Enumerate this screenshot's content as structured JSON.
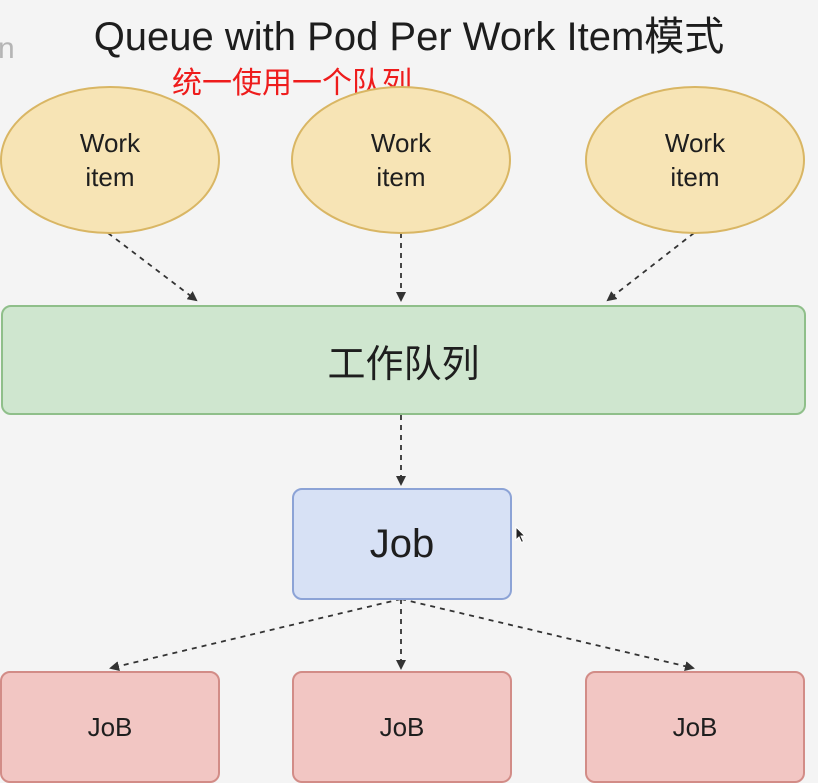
{
  "diagram": {
    "title": "Queue with Pod Per Work Item模式",
    "edge_glyph": "n",
    "annotation": "统一使用一个队列",
    "work_items": [
      {
        "line1": "Work",
        "line2": "item"
      },
      {
        "line1": "Work",
        "line2": "item"
      },
      {
        "line1": "Work",
        "line2": "item"
      }
    ],
    "queue_label": "工作队列",
    "job_label": "Job",
    "pods": [
      {
        "label": "JoB"
      },
      {
        "label": "JoB"
      },
      {
        "label": "JoB"
      }
    ],
    "colors": {
      "work_item_fill": "#f7e4b5",
      "queue_fill": "#cfe6cf",
      "job_fill": "#d7e1f5",
      "pod_fill": "#f2c6c3",
      "annotation": "#ee1c1c",
      "arrow": "#333333"
    }
  }
}
